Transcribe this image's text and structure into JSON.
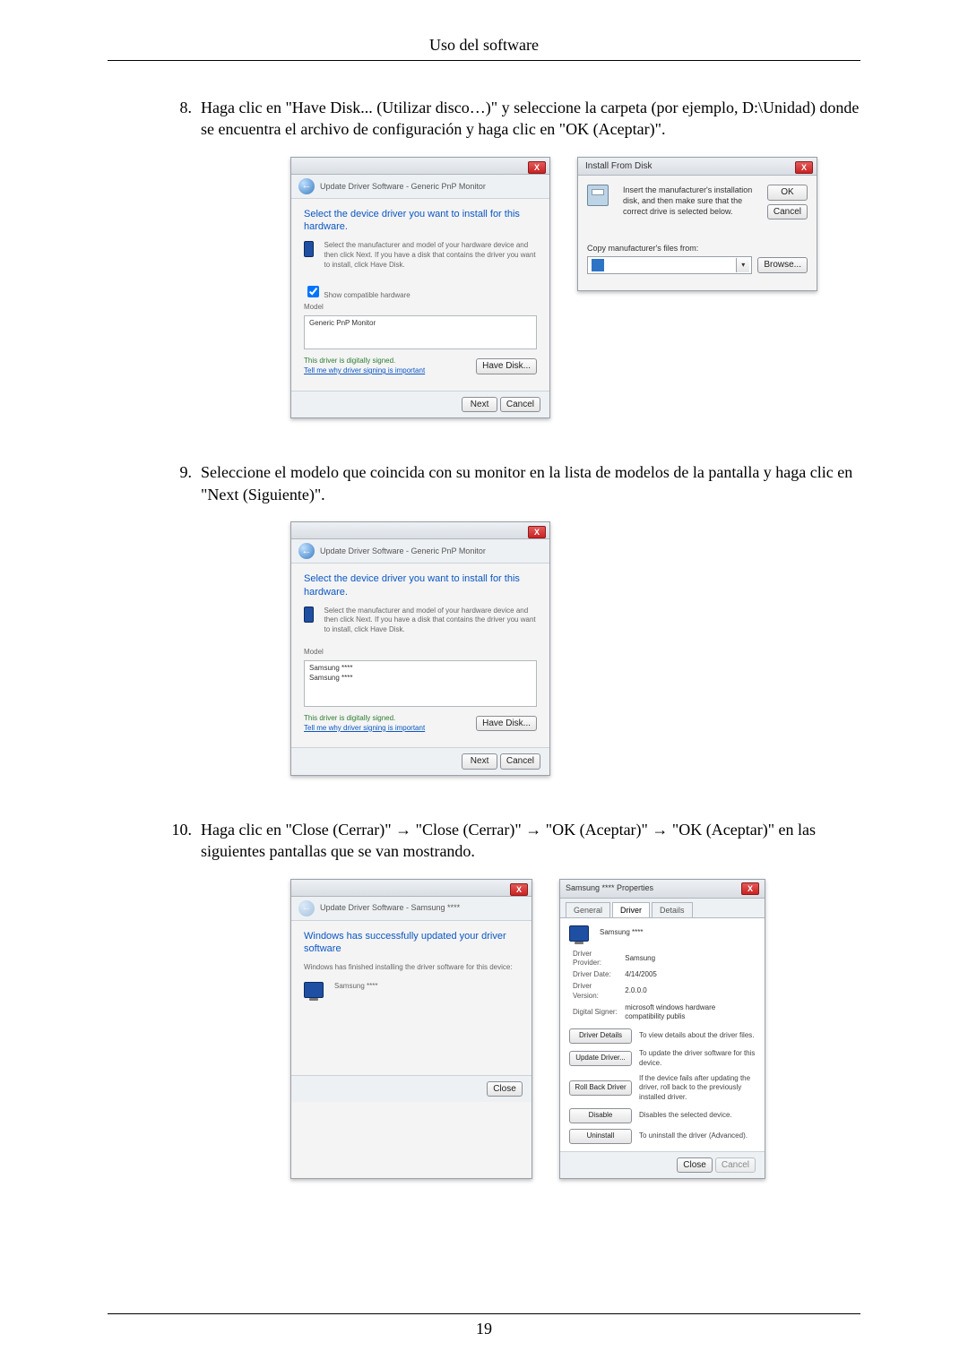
{
  "header": "Uso del software",
  "pageNumber": "19",
  "steps": {
    "s8": {
      "num": "8.",
      "text": "Haga clic en \"Have Disk... (Utilizar disco…)\" y seleccione la carpeta (por ejemplo, D:\\Unidad) donde se encuentra el archivo de configuración y haga clic en \"OK (Aceptar)\"."
    },
    "s9": {
      "num": "9.",
      "text": "Seleccione el modelo que coincida con su monitor en la lista de modelos de la pantalla y haga clic en \"Next (Siguiente)\"."
    },
    "s10": {
      "num": "10.",
      "text": "Haga clic en \"Close (Cerrar)\" → \"Close (Cerrar)\" → \"OK (Aceptar)\" → \"OK (Aceptar)\" en las siguientes pantallas que se van mostrando."
    }
  },
  "wizard8": {
    "navTitle": "Update Driver Software - Generic PnP Monitor",
    "heading": "Select the device driver you want to install for this hardware.",
    "explain": "Select the manufacturer and model of your hardware device and then click Next. If you have a disk that contains the driver you want to install, click Have Disk.",
    "showCompat": "Show compatible hardware",
    "modelLabel": "Model",
    "models": [
      "Generic PnP Monitor"
    ],
    "signed": "This driver is digitally signed.",
    "signedLink": "Tell me why driver signing is important",
    "haveDisk": "Have Disk...",
    "next": "Next",
    "cancel": "Cancel"
  },
  "ifd": {
    "title": "Install From Disk",
    "insertText": "Insert the manufacturer's installation disk, and then make sure that the correct drive is selected below.",
    "ok": "OK",
    "cancel": "Cancel",
    "copyLabel": "Copy manufacturer's files from:",
    "browse": "Browse..."
  },
  "wizard9": {
    "navTitle": "Update Driver Software - Generic PnP Monitor",
    "heading": "Select the device driver you want to install for this hardware.",
    "explain": "Select the manufacturer and model of your hardware device and then click Next. If you have a disk that contains the driver you want to install, click Have Disk.",
    "modelLabel": "Model",
    "models": [
      "Samsung ****",
      "Samsung ****"
    ],
    "signed": "This driver is digitally signed.",
    "signedLink": "Tell me why driver signing is important",
    "haveDisk": "Have Disk...",
    "next": "Next",
    "cancel": "Cancel"
  },
  "wizard10a": {
    "navTitle": "Update Driver Software - Samsung ****",
    "heading": "Windows has successfully updated your driver software",
    "finishText": "Windows has finished installing the driver software for this device:",
    "device": "Samsung ****",
    "close": "Close"
  },
  "props": {
    "title": "Samsung **** Properties",
    "tabs": [
      "General",
      "Driver",
      "Details"
    ],
    "activeTab": "Driver",
    "device": "Samsung ****",
    "kv": [
      {
        "k": "Driver Provider:",
        "v": "Samsung"
      },
      {
        "k": "Driver Date:",
        "v": "4/14/2005"
      },
      {
        "k": "Driver Version:",
        "v": "2.0.0.0"
      },
      {
        "k": "Digital Signer:",
        "v": "microsoft windows hardware compatibility publis"
      }
    ],
    "actions": [
      {
        "btn": "Driver Details",
        "desc": "To view details about the driver files."
      },
      {
        "btn": "Update Driver...",
        "desc": "To update the driver software for this device."
      },
      {
        "btn": "Roll Back Driver",
        "desc": "If the device fails after updating the driver, roll back to the previously installed driver."
      },
      {
        "btn": "Disable",
        "desc": "Disables the selected device."
      },
      {
        "btn": "Uninstall",
        "desc": "To uninstall the driver (Advanced)."
      }
    ],
    "closeBtn": "Close",
    "cancel": "Cancel"
  }
}
